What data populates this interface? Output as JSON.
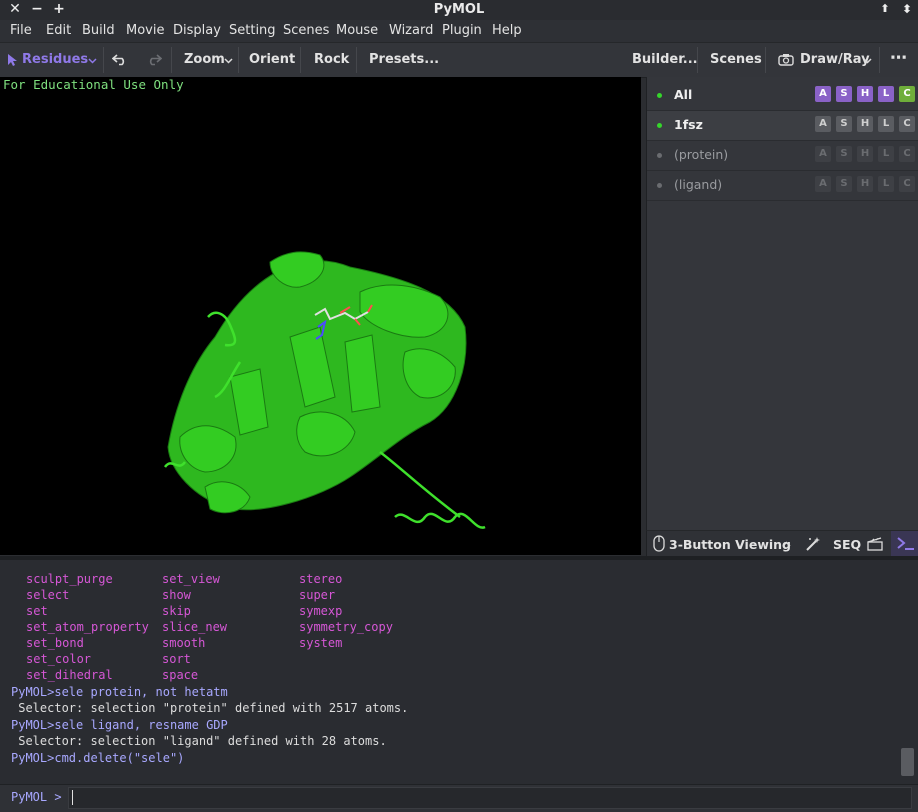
{
  "window": {
    "title": "PyMOL",
    "close": "✕",
    "minimize": "−",
    "maximize": "+",
    "pin": "⬆",
    "extra": "⬍"
  },
  "menu": [
    "File",
    "Edit",
    "Build",
    "Movie",
    "Display",
    "Setting",
    "Scenes",
    "Mouse",
    "Wizard",
    "Plugin",
    "Help"
  ],
  "toolbar": {
    "mode": "Residues",
    "zoom": "Zoom",
    "orient": "Orient",
    "rock": "Rock",
    "presets": "Presets...",
    "builder": "Builder...",
    "scenes": "Scenes",
    "drawray": "Draw/Ray",
    "more": "⋯"
  },
  "viewer": {
    "watermark": "For Educational Use Only"
  },
  "objects": [
    {
      "name": "All",
      "active": true,
      "bold": true
    },
    {
      "name": "1fsz",
      "active": true,
      "bold": true
    },
    {
      "name": "(protein)",
      "active": false,
      "bold": false
    },
    {
      "name": "(ligand)",
      "active": false,
      "bold": false
    }
  ],
  "action_letters": [
    "A",
    "S",
    "H",
    "L",
    "C"
  ],
  "panel_footer": {
    "mouse_mode": "3-Button Viewing",
    "seq": "SEQ"
  },
  "console": {
    "commands_col1": [
      "sculpt_purge",
      "select",
      "set",
      "set_atom_property",
      "set_bond",
      "set_color",
      "set_dihedral"
    ],
    "commands_col2": [
      "set_view",
      "show",
      "skip",
      "slice_new",
      "smooth",
      "sort",
      "space"
    ],
    "commands_col3": [
      "stereo",
      "super",
      "symexp",
      "symmetry_copy",
      "system"
    ],
    "log": [
      {
        "kind": "prompt",
        "text": "PyMOL>sele protein, not hetatm"
      },
      {
        "kind": "output",
        "text": " Selector: selection \"protein\" defined with 2517 atoms."
      },
      {
        "kind": "prompt",
        "text": "PyMOL>sele ligand, resname GDP"
      },
      {
        "kind": "output",
        "text": " Selector: selection \"ligand\" defined with 28 atoms."
      },
      {
        "kind": "prompt",
        "text": "PyMOL>cmd.delete(\"sele\")"
      }
    ]
  },
  "cmdline": {
    "prompt": "PyMOL >",
    "value": ""
  },
  "colors": {
    "accent": "#8f79e8",
    "green": "#35d62b",
    "magenta": "#d657d6"
  }
}
